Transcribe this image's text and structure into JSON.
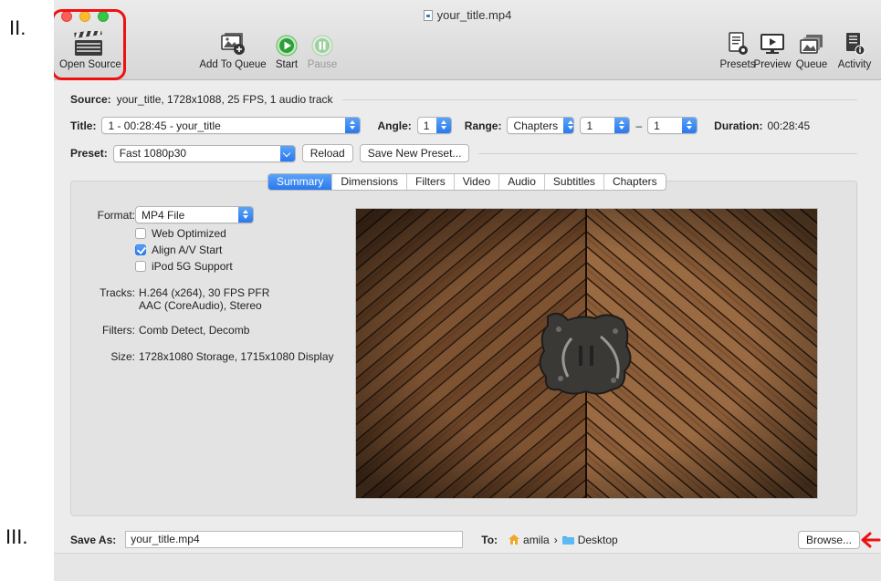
{
  "annotations": {
    "step_ii": "II.",
    "step_iii": "III."
  },
  "window": {
    "title": "your_title.mp4"
  },
  "toolbar": {
    "open_source": "Open Source",
    "add_to_queue": "Add To Queue",
    "start": "Start",
    "pause": "Pause",
    "presets": "Presets",
    "preview": "Preview",
    "queue": "Queue",
    "activity": "Activity"
  },
  "source": {
    "label": "Source:",
    "value": "your_title, 1728x1088, 25 FPS, 1 audio track"
  },
  "title_row": {
    "title_label": "Title:",
    "title_value": "1 - 00:28:45 - your_title",
    "angle_label": "Angle:",
    "angle_value": "1",
    "range_label": "Range:",
    "range_type": "Chapters",
    "range_start": "1",
    "range_dash": "–",
    "range_end": "1",
    "duration_label": "Duration:",
    "duration_value": "00:28:45"
  },
  "preset_row": {
    "label": "Preset:",
    "value": "Fast 1080p30",
    "reload": "Reload",
    "save_new": "Save New Preset..."
  },
  "tabs": [
    "Summary",
    "Dimensions",
    "Filters",
    "Video",
    "Audio",
    "Subtitles",
    "Chapters"
  ],
  "active_tab": "Summary",
  "summary": {
    "format_label": "Format:",
    "format_value": "MP4 File",
    "web_optimized": "Web Optimized",
    "align_av": "Align A/V Start",
    "ipod": "iPod 5G Support",
    "tracks_label": "Tracks:",
    "tracks_line1": "H.264 (x264), 30 FPS PFR",
    "tracks_line2": "AAC (CoreAudio), Stereo",
    "filters_label": "Filters:",
    "filters_value": "Comb Detect, Decomb",
    "size_label": "Size:",
    "size_value": "1728x1080 Storage, 1715x1080 Display"
  },
  "checkboxes": {
    "web_optimized": false,
    "align_av": true,
    "ipod": false
  },
  "save_row": {
    "save_as_label": "Save As:",
    "save_as_value": "your_title.mp4",
    "to_label": "To:",
    "path_user": "amila",
    "path_sep": "›",
    "path_folder": "Desktop",
    "browse": "Browse..."
  },
  "colors": {
    "accent": "#2a78ef",
    "annotation_red": "#e11111"
  }
}
